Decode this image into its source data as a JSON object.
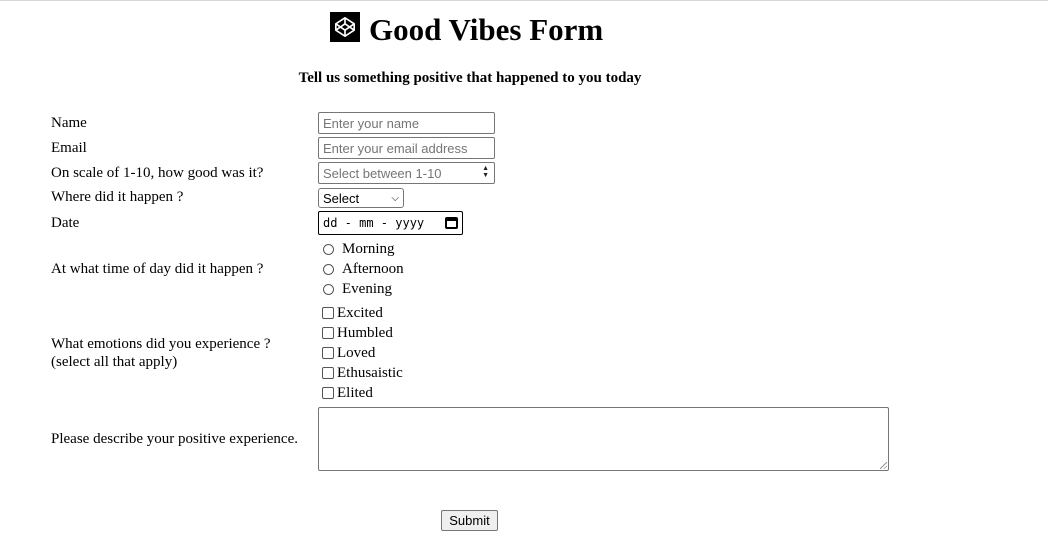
{
  "header": {
    "title": "Good Vibes Form",
    "subtitle": "Tell us something positive that happened to you today",
    "logo_icon": "codepen-logo-icon"
  },
  "form": {
    "name": {
      "label": "Name",
      "placeholder": "Enter your name"
    },
    "email": {
      "label": "Email",
      "placeholder": "Enter your email address"
    },
    "scale": {
      "label": "On scale of 1-10, how good was it?",
      "placeholder": "Select between 1-10"
    },
    "location": {
      "label": "Where did it happen ?",
      "selected": "Select"
    },
    "date": {
      "label": "Date",
      "placeholder": "dd - mm - yyyy"
    },
    "time_of_day": {
      "label": "At what time of day did it happen ?",
      "options": [
        "Morning",
        "Afternoon",
        "Evening"
      ]
    },
    "emotions": {
      "label": "What emotions did you experience ?",
      "hint": "(select all that apply)",
      "options": [
        "Excited",
        "Humbled",
        "Loved",
        "Ethusaistic",
        "Elited"
      ]
    },
    "description": {
      "label": "Please describe your positive experience."
    },
    "submit_label": "Submit"
  }
}
